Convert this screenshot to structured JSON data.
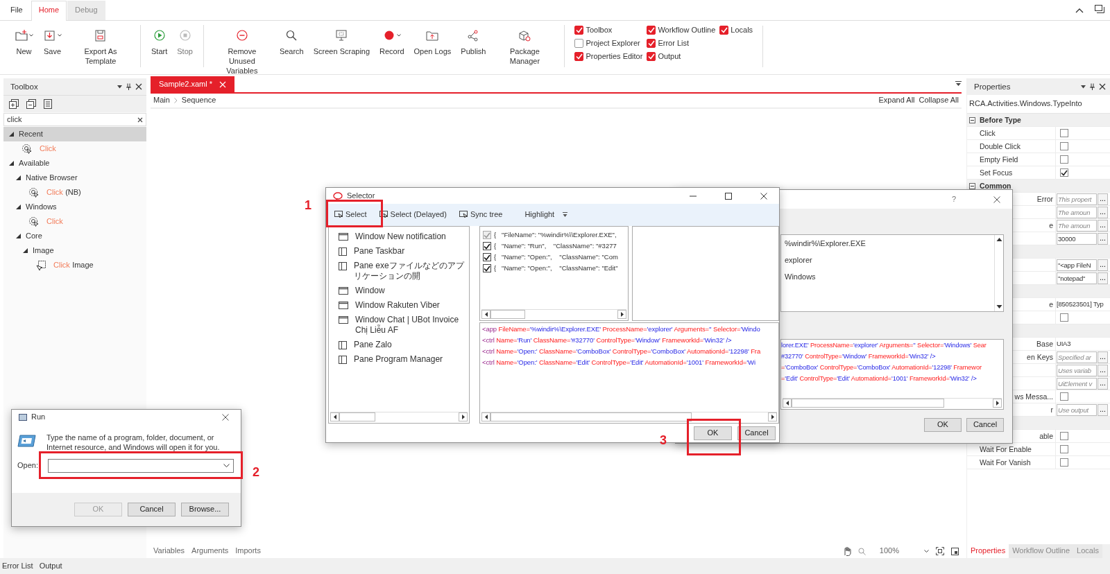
{
  "menu_tabs": [
    {
      "label": "File",
      "selected": false
    },
    {
      "label": "Home",
      "selected": true
    },
    {
      "label": "Debug",
      "selected": false
    }
  ],
  "ribbon": {
    "groups": [
      [
        {
          "label": "New",
          "kind": "new",
          "dropdown": true,
          "disabled": false
        },
        {
          "label": "Save",
          "kind": "save",
          "dropdown": true,
          "disabled": false
        },
        {
          "label": "Export As Template",
          "kind": "export",
          "dropdown": false,
          "disabled": false
        }
      ],
      [
        {
          "label": "Start",
          "kind": "start",
          "dropdown": false,
          "disabled": false
        },
        {
          "label": "Stop",
          "kind": "stop",
          "dropdown": false,
          "disabled": true
        }
      ],
      [
        {
          "label": "Remove Unused Variables",
          "kind": "remove",
          "dropdown": false,
          "disabled": false
        },
        {
          "label": "Search",
          "kind": "search",
          "dropdown": false,
          "disabled": false
        },
        {
          "label": "Screen Scraping",
          "kind": "scrape",
          "dropdown": false,
          "disabled": false
        },
        {
          "label": "Record",
          "kind": "record",
          "dropdown": true,
          "disabled": false
        },
        {
          "label": "Open Logs",
          "kind": "logs",
          "dropdown": false,
          "disabled": false
        },
        {
          "label": "Publish",
          "kind": "publish",
          "dropdown": false,
          "disabled": false
        },
        {
          "label": "Package Manager",
          "kind": "package",
          "dropdown": false,
          "disabled": false
        }
      ]
    ],
    "panels": [
      {
        "label": "Toolbox",
        "checked": true
      },
      {
        "label": "Project Explorer",
        "checked": false
      },
      {
        "label": "Properties Editor",
        "checked": true
      },
      {
        "label": "Workflow Outline",
        "checked": true
      },
      {
        "label": "Error List",
        "checked": true
      },
      {
        "label": "Output",
        "checked": true
      },
      {
        "label": "Locals",
        "checked": true
      }
    ]
  },
  "toolbox": {
    "title": "Toolbox",
    "search": {
      "value": "click"
    },
    "tree": [
      {
        "kind": "group",
        "label": "Recent",
        "expanded": true,
        "selected": true,
        "children": [
          {
            "kind": "click",
            "match": "Click",
            "selected": false
          }
        ]
      },
      {
        "kind": "group",
        "label": "Available",
        "expanded": true,
        "selected": false,
        "children": [
          {
            "kind": "group",
            "label": "Native Browser",
            "expanded": true,
            "selected": false,
            "children": [
              {
                "kind": "click",
                "match": "Click",
                "rest": "(NB)",
                "selected": false
              }
            ]
          },
          {
            "kind": "group",
            "label": "Windows",
            "expanded": true,
            "selected": false,
            "children": [
              {
                "kind": "click",
                "match": "Click",
                "selected": false
              }
            ]
          },
          {
            "kind": "group",
            "label": "Core",
            "expanded": true,
            "selected": false,
            "children": [
              {
                "kind": "group",
                "label": "Image",
                "expanded": true,
                "selected": false,
                "children": [
                  {
                    "kind": "image_click",
                    "match": "Click",
                    "rest": "Image",
                    "selected": false
                  }
                ]
              }
            ]
          }
        ]
      }
    ]
  },
  "document": {
    "tab": {
      "label": "Sample2.xaml *"
    },
    "breadcrumb": [
      "Main",
      "Sequence"
    ],
    "actions": [
      "Expand All",
      "Collapse All"
    ],
    "bottom_tabs": [
      "Variables",
      "Arguments",
      "Imports"
    ],
    "zoom": "100%"
  },
  "properties": {
    "title": "Properties",
    "type_name": "RCA.Activities.Windows.TypeInto",
    "rows": [
      {
        "kind": "section",
        "label": "Before Type"
      },
      {
        "kind": "check",
        "label": "Click",
        "partial": false,
        "checked": false
      },
      {
        "kind": "check",
        "label": "Double Click",
        "partial": false,
        "checked": false
      },
      {
        "kind": "check",
        "label": "Empty Field",
        "partial": false,
        "checked": false
      },
      {
        "kind": "check",
        "label": "Set Focus",
        "partial": false,
        "checked": true
      },
      {
        "kind": "section",
        "label": "Common"
      },
      {
        "kind": "input",
        "label": "Error",
        "partial": true,
        "placeholder": "This propert",
        "action": "..."
      },
      {
        "kind": "input",
        "placeholder": "The amoun",
        "action": "..."
      },
      {
        "kind": "input",
        "label": "e",
        "partial": true,
        "placeholder": "The amoun",
        "action": "..."
      },
      {
        "kind": "input",
        "value": "30000",
        "action": "..."
      },
      {
        "kind": "section"
      },
      {
        "kind": "input",
        "value": "\"<app FileN",
        "action": "..."
      },
      {
        "kind": "input",
        "value": "\"notepad\"",
        "action": "..."
      },
      {
        "kind": "section"
      },
      {
        "kind": "text",
        "label": "e",
        "partial": true,
        "value": "[850523501] Typ"
      },
      {
        "kind": "check",
        "checked": false
      },
      {
        "kind": "section"
      },
      {
        "kind": "text",
        "label": "Base",
        "partial": true,
        "value": "UIA3"
      },
      {
        "kind": "input",
        "label": "en Keys",
        "partial": true,
        "placeholder": "Specified ar",
        "action": "..."
      },
      {
        "kind": "input",
        "placeholder": "Uses variab",
        "action": "..."
      },
      {
        "kind": "input",
        "placeholder": "UiElement v",
        "action": "..."
      },
      {
        "kind": "check",
        "label": "ws Messa...",
        "partial": true,
        "checked": false
      },
      {
        "kind": "input",
        "label": "r",
        "partial": true,
        "placeholder": "Use output",
        "action": "..."
      },
      {
        "kind": "section"
      },
      {
        "kind": "check",
        "label": "able",
        "partial": true,
        "checked": false
      },
      {
        "kind": "check",
        "label": "Wait For Enable",
        "partial": false,
        "checked": false
      },
      {
        "kind": "check",
        "label": "Wait For Vanish",
        "partial": false,
        "checked": false
      }
    ],
    "tabs": [
      {
        "label": "Properties",
        "selected": true
      },
      {
        "label": "Workflow Outline",
        "selected": false
      },
      {
        "label": "Locals",
        "selected": false
      }
    ]
  },
  "status_tabs": [
    "Error List",
    "Output"
  ],
  "selector": {
    "title": "Selector",
    "toolbar": [
      {
        "label": "Select",
        "kind": "pick"
      },
      {
        "label": "Select (Delayed)",
        "kind": "pick"
      },
      {
        "label": "Sync tree",
        "kind": "pick"
      },
      {
        "label": "Highlight",
        "kind": "menu"
      }
    ],
    "elements": [
      {
        "kind": "window",
        "label": "Window New notification"
      },
      {
        "kind": "pane",
        "label": "Pane Taskbar"
      },
      {
        "kind": "pane",
        "label": "Pane exeファイルなどのアプリケーションの開"
      },
      {
        "kind": "window",
        "label": "Window"
      },
      {
        "kind": "window",
        "label": "Window Rakuten Viber"
      },
      {
        "kind": "window",
        "label": "Window Chat | UBot Invoice Chị Liễu AF"
      },
      {
        "kind": "pane",
        "label": "Pane Zalo"
      },
      {
        "kind": "pane",
        "label": "Pane Program Manager"
      }
    ],
    "attributes": [
      {
        "text": "{   \"FileName\": \"%windir%\\\\Explorer.EXE\",",
        "checked": true,
        "disabled": true
      },
      {
        "text": "{   \"Name\": \"Run\",    \"ClassName\": \"#3277",
        "checked": true,
        "disabled": false
      },
      {
        "text": "{   \"Name\": \"Open:\",    \"ClassName\": \"Com",
        "checked": true,
        "disabled": false
      },
      {
        "text": "{   \"Name\": \"Open:\",    \"ClassName\": \"Edit\"",
        "checked": true,
        "disabled": false
      }
    ],
    "lines": [
      {
        "text": "<app FileName='%windir%\\Explorer.EXE' ProcessName='explorer' Arguments='' Selector='Windo",
        "open_value": false
      },
      {
        "text": "<ctrl Name='Run' ClassName='#32770' ControlType='Window' FrameworkId='Win32' />",
        "open_value": false
      },
      {
        "text": "<ctrl Name='Open:' ClassName='ComboBox' ControlType='ComboBox' AutomationId='12298' Fra",
        "open_value": false
      },
      {
        "text": "<ctrl Name='Open:' ClassName='Edit' ControlType='Edit' AutomationId='1001' FrameworkId='Wi",
        "open_value": false
      }
    ],
    "buttons": [
      "OK",
      "Cancel"
    ]
  },
  "editor": {
    "help": "?",
    "values": [
      "%windir%\\Explorer.EXE",
      "explorer",
      "Windows"
    ],
    "lines": [
      {
        "text": "lorer.EXE' ProcessName='explorer' Arguments='' Selector='Windows' Sear",
        "open_value": true
      },
      {
        "text": "#32770' ControlType='Window' FrameworkId='Win32' />",
        "open_value": true
      },
      {
        "text": "='ComboBox' ControlType='ComboBox' AutomationId='12298' Framewor",
        "open_value": false
      },
      {
        "text": "='Edit' ControlType='Edit' AutomationId='1001' FrameworkId='Win32' />",
        "open_value": false
      }
    ],
    "buttons": [
      "OK",
      "Cancel"
    ]
  },
  "run": {
    "title": "Run",
    "message": "Type the name of a program, folder, document, or Internet resource, and Windows will open it for you.",
    "open_label": "Open:",
    "buttons": [
      {
        "label": "OK",
        "disabled": true
      },
      {
        "label": "Cancel",
        "disabled": false
      },
      {
        "label": "Browse...",
        "disabled": false
      }
    ]
  },
  "annotations": [
    {
      "label": "1"
    },
    {
      "label": "2"
    },
    {
      "label": "3"
    }
  ]
}
